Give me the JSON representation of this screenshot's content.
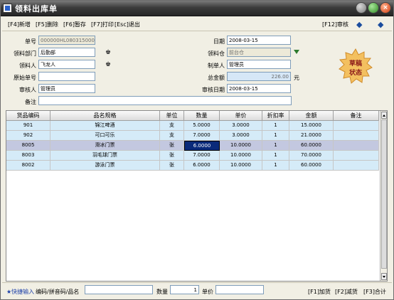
{
  "window": {
    "title": "领料出库单"
  },
  "toolbar": {
    "items": [
      "[F4]新增",
      "[F5]删除",
      "[F6]暂存",
      "[F7]打印",
      "[Esc]退出"
    ],
    "right": "[F12]审核"
  },
  "form": {
    "doc_no_label": "单号",
    "doc_no": "000000HL0803150007",
    "date_label": "日期",
    "date": "2008-03-15",
    "dept_label": "领料部门",
    "dept": "后勤部",
    "warehouse_label": "领料仓",
    "warehouse": "前台仓",
    "picker_label": "领料人",
    "picker": "飞龙人",
    "creator_label": "制单人",
    "creator": "管理员",
    "orig_no_label": "原始单号",
    "orig_no": "",
    "total_label": "总金额",
    "total": "226.00",
    "total_unit": "元",
    "auditor_label": "审核人",
    "auditor": "管理员",
    "audit_date_label": "审核日期",
    "audit_date": "2008-03-15",
    "remark_label": "备注",
    "remark": ""
  },
  "stamp": {
    "line1": "草稿",
    "line2": "状态",
    "color": "#8c1a1a"
  },
  "table": {
    "columns": [
      "货品编码",
      "品名规格",
      "单位",
      "数量",
      "单价",
      "折扣率",
      "金额",
      "备注"
    ],
    "rows": [
      [
        "901",
        "锦江啤酒",
        "支",
        "5.0000",
        "3.0000",
        "1",
        "15.0000",
        ""
      ],
      [
        "902",
        "可口可乐",
        "支",
        "7.0000",
        "3.0000",
        "1",
        "21.0000",
        ""
      ],
      [
        "8005",
        "滑冰门票",
        "张",
        "6.0000",
        "10.0000",
        "1",
        "60.0000",
        ""
      ],
      [
        "8003",
        "羽毛球门票",
        "张",
        "7.0000",
        "10.0000",
        "1",
        "70.0000",
        ""
      ],
      [
        "8002",
        "游泳门票",
        "张",
        "6.0000",
        "10.0000",
        "1",
        "60.0000",
        ""
      ]
    ],
    "selected_row": 2
  },
  "bottom": {
    "quick_label": "★快捷输入",
    "code_label": "编码/拼音码/品名",
    "code_value": "",
    "qty_label": "数量",
    "qty_value": "1",
    "price_label": "单价",
    "price_value": "",
    "actions": [
      "[F1]加货",
      "[F2]减货",
      "[F3]合计"
    ]
  }
}
